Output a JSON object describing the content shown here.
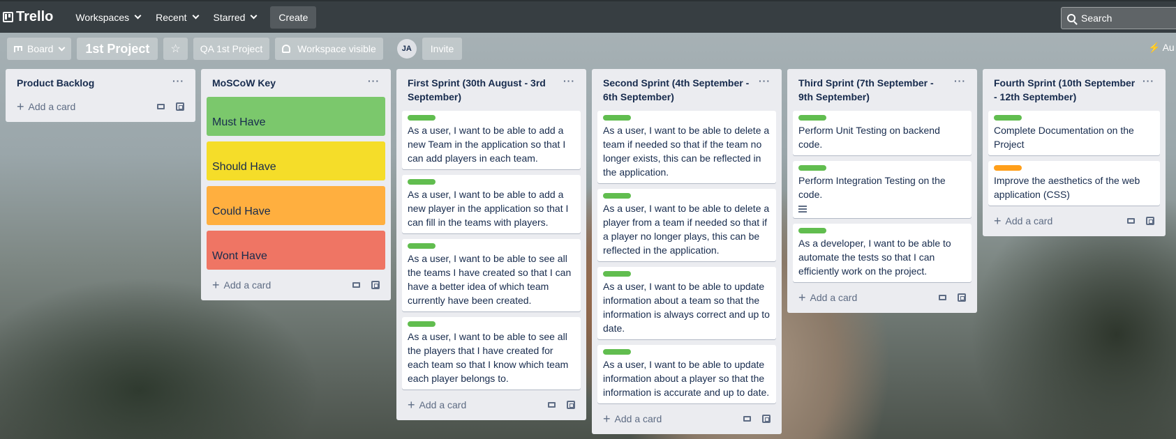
{
  "topbar": {
    "logo": "Trello",
    "nav": [
      "Workspaces",
      "Recent",
      "Starred"
    ],
    "create": "Create",
    "search_placeholder": "Search"
  },
  "boardbar": {
    "view": "Board",
    "title": "1st Project",
    "workspace": "QA 1st Project",
    "visibility": "Workspace visible",
    "avatar": "JA",
    "invite": "Invite",
    "automation": "Au"
  },
  "add_card_label": "Add a card",
  "lists": [
    {
      "title": "Product Backlog"
    },
    {
      "title": "MoSCoW Key",
      "color_cards": [
        {
          "text": "Must Have",
          "color": "#7bc86c"
        },
        {
          "text": "Should Have",
          "color": "#f5dd29"
        },
        {
          "text": "Could Have",
          "color": "#ffaf3f"
        },
        {
          "text": "Wont Have",
          "color": "#ef7564"
        }
      ]
    },
    {
      "title": "First Sprint (30th August - 3rd September)",
      "cards": [
        "As a user, I want to be able to add a new Team in the application so that I can add players in each team.",
        "As a user, I want to be able to add a new player in the application so that I can fill in the teams with players.",
        "As a user, I want to be able to see all the teams I have created so that I can have a better idea of which team currently have been created.",
        "As a user, I want to be able to see all the players that I have created for each team so that I know which team each player belongs to."
      ]
    },
    {
      "title": "Second Sprint (4th September - 6th September)",
      "cards": [
        "As a user, I want to be able to delete a team if needed so that if the team no longer exists, this can be reflected in the application.",
        "As a user, I want to be able to delete a player from a team if needed so that if a player no longer plays, this can be reflected in the application.",
        "As a user, I want to be able to update information about a team so that the information is always correct and up to date.",
        "As a user, I want to be able to update information about a player so that the information is accurate and up to date."
      ]
    },
    {
      "title": "Third Sprint (7th September - 9th September)",
      "cards": [
        "Perform Unit Testing on backend code.",
        "Perform Integration Testing on the code.",
        "As a developer, I want to be able to automate the tests so that I can efficiently work on the project."
      ]
    },
    {
      "title": "Fourth Sprint (10th September - 12th September)",
      "cards": [
        "Complete Documentation on the Project",
        "Improve the aesthetics of the web application (CSS)"
      ],
      "label_colors": [
        "#61bd4f",
        "#ff9f1a"
      ]
    }
  ]
}
